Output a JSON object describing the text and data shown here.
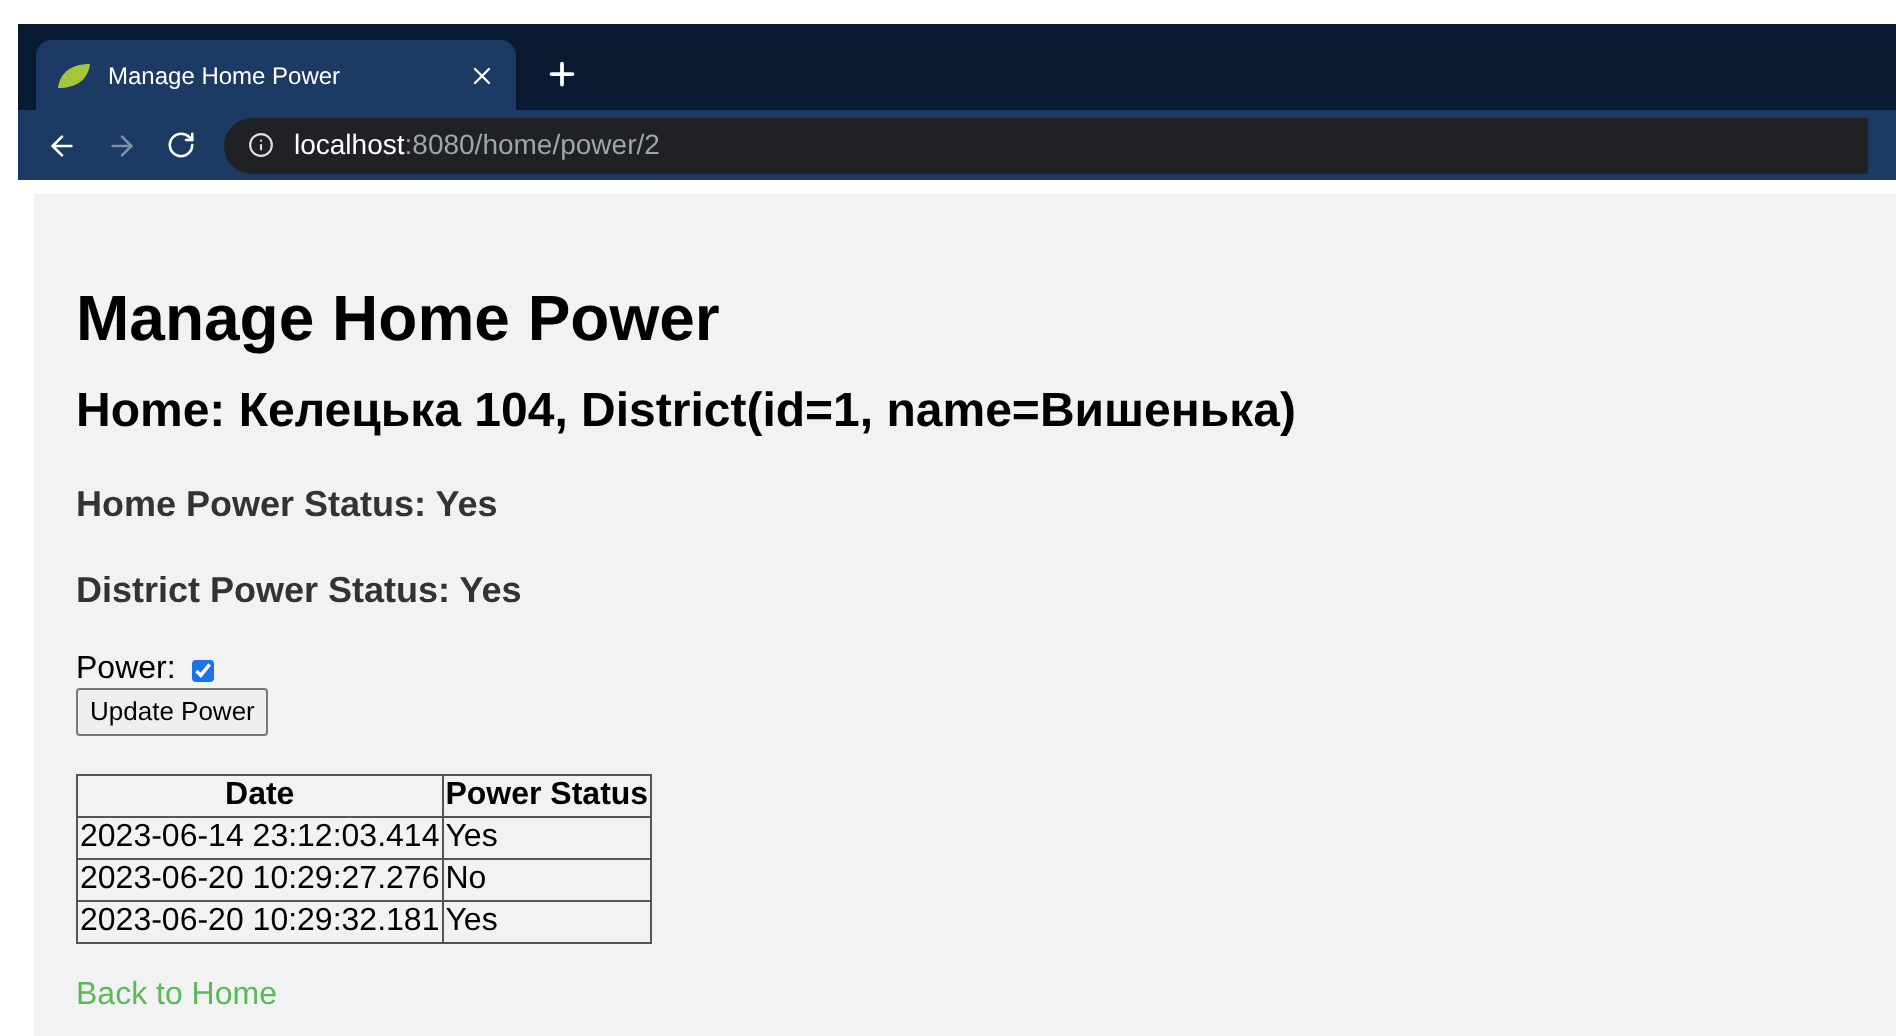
{
  "browser": {
    "tab_title": "Manage Home Power",
    "url_host": "localhost",
    "url_path": ":8080/home/power/2"
  },
  "page": {
    "title": "Manage Home Power",
    "home": "Home: Келецька 104, District(id=1, name=Вишенька)",
    "home_status": "Home Power Status: Yes",
    "district_status": "District Power Status: Yes",
    "power_label": "Power:",
    "power_checked": true,
    "button": "Update Power",
    "table": {
      "columns": [
        "Date",
        "Power Status"
      ],
      "rows": [
        [
          "2023-06-14 23:12:03.414",
          "Yes"
        ],
        [
          "2023-06-20 10:29:27.276",
          "No"
        ],
        [
          "2023-06-20 10:29:32.181",
          "Yes"
        ]
      ]
    },
    "back_link": "Back to Home"
  }
}
